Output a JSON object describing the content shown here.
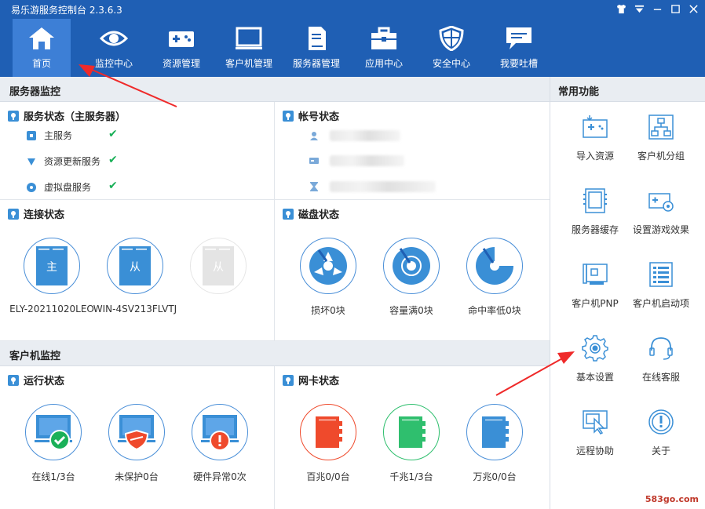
{
  "window": {
    "title": "易乐游服务控制台 2.3.6.3"
  },
  "nav": [
    {
      "id": "home",
      "label": "首页",
      "icon": "home-icon",
      "active": true
    },
    {
      "id": "monitor",
      "label": "监控中心",
      "icon": "eye-icon"
    },
    {
      "id": "resource",
      "label": "资源管理",
      "icon": "gamepad-icon"
    },
    {
      "id": "client",
      "label": "客户机管理",
      "icon": "monitor-icon"
    },
    {
      "id": "server",
      "label": "服务器管理",
      "icon": "server-icon"
    },
    {
      "id": "app",
      "label": "应用中心",
      "icon": "toolbox-icon"
    },
    {
      "id": "security",
      "label": "安全中心",
      "icon": "shield-icon"
    },
    {
      "id": "feedback",
      "label": "我要吐槽",
      "icon": "chat-icon"
    }
  ],
  "server_monitor": {
    "header": "服务器监控",
    "service_status": {
      "title": "服务状态（主服务器）",
      "items": [
        {
          "label": "主服务",
          "status": "ok"
        },
        {
          "label": "资源更新服务",
          "status": "ok"
        },
        {
          "label": "虚拟盘服务",
          "status": "ok"
        }
      ]
    },
    "account_status": {
      "title": "帐号状态"
    },
    "connection_status": {
      "title": "连接状态",
      "servers": [
        {
          "badge": "主",
          "name": "ELY-20211020LEO"
        },
        {
          "badge": "从",
          "name": "WIN-4SV213FLVTJ"
        },
        {
          "badge": "从",
          "name": ""
        }
      ]
    },
    "disk_status": {
      "title": "磁盘状态",
      "items": [
        {
          "label": "损坏0块",
          "icon": "disk-damaged-icon"
        },
        {
          "label": "容量满0块",
          "icon": "disk-full-icon"
        },
        {
          "label": "命中率低0块",
          "icon": "disk-hitrate-icon"
        }
      ]
    }
  },
  "client_monitor": {
    "header": "客户机监控",
    "run_status": {
      "title": "运行状态",
      "items": [
        {
          "label": "在线1/3台",
          "icon": "online-icon"
        },
        {
          "label": "未保护0台",
          "icon": "unprotected-icon"
        },
        {
          "label": "硬件异常0次",
          "icon": "hardware-error-icon"
        }
      ]
    },
    "nic_status": {
      "title": "网卡状态",
      "items": [
        {
          "label": "百兆0/0台",
          "icon": "nic-100m-icon",
          "color": "#ef4a2c"
        },
        {
          "label": "千兆1/3台",
          "icon": "nic-1000m-icon",
          "color": "#2fbf6e"
        },
        {
          "label": "万兆0/0台",
          "icon": "nic-10g-icon",
          "color": "#3a8fd6"
        }
      ]
    }
  },
  "common_functions": {
    "header": "常用功能",
    "items": [
      {
        "label": "导入资源",
        "icon": "import-resource-icon"
      },
      {
        "label": "客户机分组",
        "icon": "client-group-icon"
      },
      {
        "label": "服务器缓存",
        "icon": "server-cache-icon"
      },
      {
        "label": "设置游戏效果",
        "icon": "game-effect-icon"
      },
      {
        "label": "客户机PNP",
        "icon": "pnp-icon"
      },
      {
        "label": "客户机启动项",
        "icon": "startup-icon"
      },
      {
        "label": "基本设置",
        "icon": "gear-icon"
      },
      {
        "label": "在线客服",
        "icon": "headset-icon"
      },
      {
        "label": "远程协助",
        "icon": "remote-assist-icon"
      },
      {
        "label": "关于",
        "icon": "info-icon"
      }
    ]
  },
  "watermark": "583go.com",
  "colors": {
    "brand": "#1f5fb4",
    "active_tab": "#3d7fd6",
    "ok": "#1ab058",
    "accent": "#3a8fd6"
  }
}
